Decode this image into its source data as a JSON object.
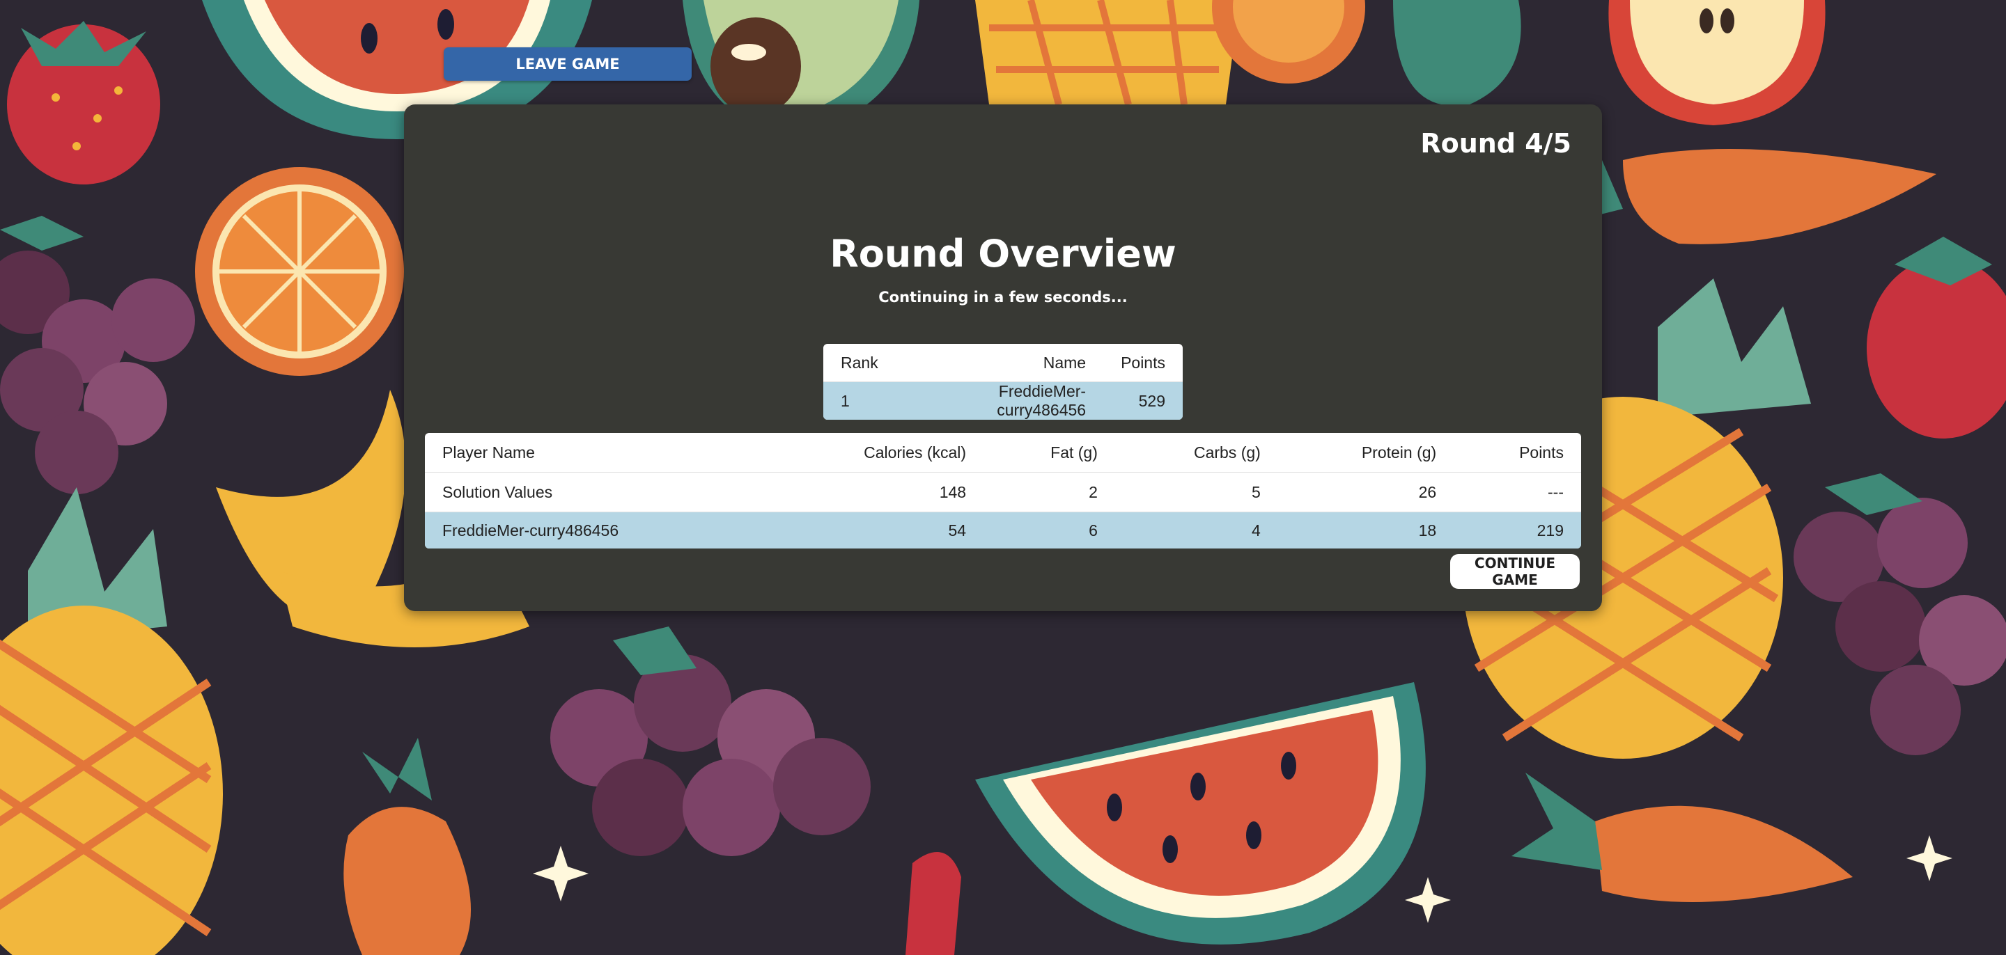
{
  "header": {
    "leave_label": "LEAVE GAME"
  },
  "round": {
    "indicator": "Round 4/5"
  },
  "overview": {
    "title": "Round Overview",
    "subtitle": "Continuing in a few seconds..."
  },
  "rank_table": {
    "headers": {
      "rank": "Rank",
      "name": "Name",
      "points": "Points"
    },
    "rows": [
      {
        "rank": "1",
        "name": "FreddieMer-curry486456",
        "points": "529"
      }
    ]
  },
  "stats_table": {
    "headers": {
      "player": "Player Name",
      "calories": "Calories (kcal)",
      "fat": "Fat (g)",
      "carbs": "Carbs (g)",
      "protein": "Protein (g)",
      "points": "Points"
    },
    "solution": {
      "player": "Solution Values",
      "calories": "148",
      "fat": "2",
      "carbs": "5",
      "protein": "26",
      "points": "---"
    },
    "player": {
      "player": "FreddieMer-curry486456",
      "calories": "54",
      "fat": "6",
      "carbs": "4",
      "protein": "18",
      "points": "219"
    }
  },
  "actions": {
    "continue_label": "CONTINUE GAME"
  },
  "colors": {
    "background": "#2d2833",
    "panel": "#383934",
    "leave_button": "#3466a8",
    "highlight_row": "#b5d6e4"
  },
  "background_icons": [
    "strawberry-icon",
    "watermelon-icon",
    "avocado-icon",
    "pineapple-icon",
    "orange-icon",
    "grapes-icon",
    "banana-icon",
    "carrot-icon",
    "apple-icon",
    "sparkle-icon"
  ]
}
